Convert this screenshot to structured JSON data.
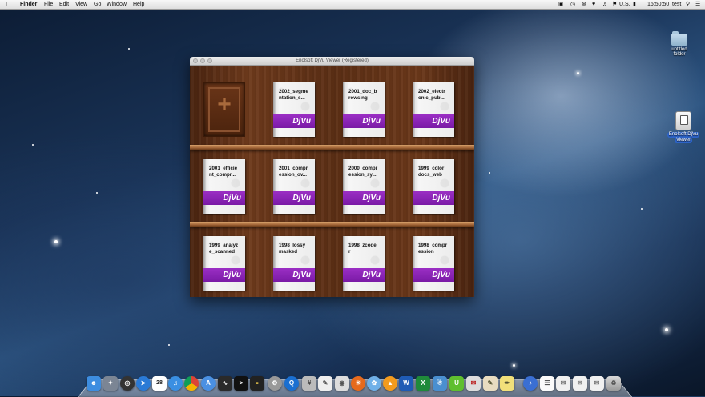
{
  "menubar": {
    "apple": "",
    "app_name": "Finder",
    "items": [
      "File",
      "Edit",
      "View",
      "Go",
      "Window",
      "Help"
    ],
    "status": {
      "input_source": "U.S.",
      "clock": "16:50:50",
      "user": "test"
    }
  },
  "desktop": {
    "icons": [
      {
        "label_line1": "untitled",
        "label_line2": "folder",
        "icon": "folder-icon"
      },
      {
        "label_line1": "Enolsoft DjVu",
        "label_line2": "Viewer",
        "icon": "app-drive-icon"
      }
    ]
  },
  "window": {
    "title": "Enolsoft DjVu Viewer (Registered)",
    "add_symbol": "+",
    "badge_text": "DjVu",
    "books": [
      [
        "2002_segme",
        "ntation_s..."
      ],
      [
        "2001_doc_b",
        "rowsing"
      ],
      [
        "2002_electr",
        "onic_publ..."
      ],
      [
        "2001_efficie",
        "nt_compr..."
      ],
      [
        "2001_compr",
        "ession_ov..."
      ],
      [
        "2000_compr",
        "ession_sy..."
      ],
      [
        "1999_color_",
        "docs_web"
      ],
      [
        "1999_analyz",
        "e_scanned"
      ],
      [
        "1998_lossy_",
        "masked"
      ],
      [
        "1998_zcode",
        "r"
      ],
      [
        "1998_compr",
        "ession"
      ]
    ]
  },
  "dock": {
    "icons": [
      "finder-icon",
      "launchpad-icon",
      "dashboard-icon",
      "safari-icon",
      "calendar-icon",
      "itunes-icon",
      "chrome-icon",
      "app-store-icon",
      "activity-monitor-icon",
      "terminal-icon",
      "console-icon",
      "system-preferences-icon",
      "quicktime-icon",
      "calculator-icon",
      "preview-icon",
      "ipod-icon",
      "firefox-icon",
      "photo-icon",
      "vlc-icon",
      "word-icon",
      "excel-icon",
      "app-icon",
      "ibooks-icon",
      "mail-icon",
      "photos-icon",
      "textedit-icon",
      "notes-icon",
      "itunes2-icon",
      "document-icon",
      "mail2-icon",
      "mail3-icon",
      "mail4-icon",
      "trash-icon"
    ],
    "calendar_day": "28"
  }
}
